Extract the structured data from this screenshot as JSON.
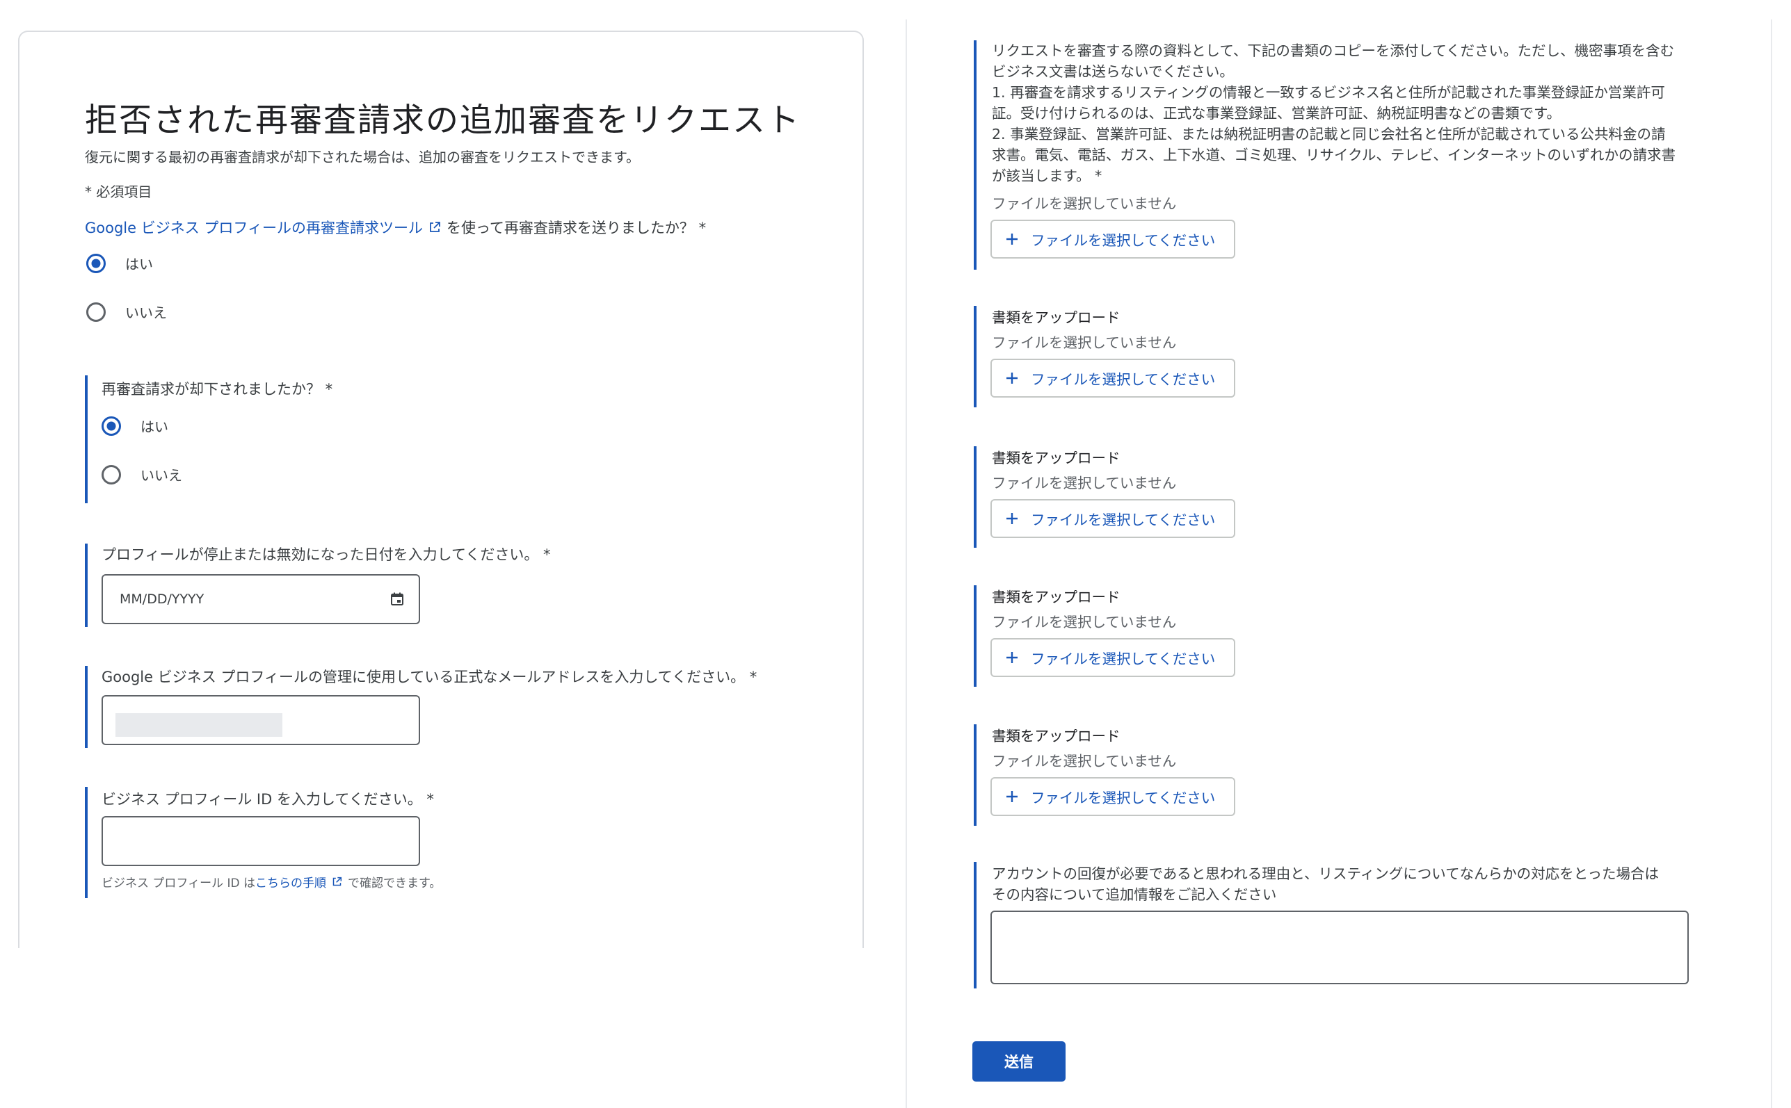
{
  "left": {
    "title": "拒否された再審査請求の追加審査をリクエスト",
    "subtitle": "復元に関する最初の再審査請求が却下された場合は、追加の審査をリクエストできます。",
    "required_note": "* 必須項目",
    "q_tool": {
      "link_text": "Google ビジネス プロフィールの再審査請求ツール",
      "suffix": "を使って再審査請求を送りましたか？ *",
      "options": [
        "はい",
        "いいえ"
      ],
      "selected": "はい"
    },
    "q_rejected": {
      "label": "再審査請求が却下されましたか？ *",
      "options": [
        "はい",
        "いいえ"
      ],
      "selected": "はい"
    },
    "date_field": {
      "label": "プロフィールが停止または無効になった日付を入力してください。 *",
      "placeholder": "MM/DD/YYYY"
    },
    "email_field": {
      "label": "Google ビジネス プロフィールの管理に使用している正式なメールアドレスを入力してください。 *"
    },
    "id_field": {
      "label": "ビジネス プロフィール ID を入力してください。 *",
      "help_prefix": "ビジネス プロフィール ID は",
      "help_link": "こちらの手順",
      "help_suffix": "で確認できます。"
    }
  },
  "right": {
    "instructions": [
      "リクエストを審査する際の資料として、下記の書類のコピーを添付してください。ただし、機密事項を含む",
      "ビジネス文書は送らないでください。",
      "1. 再審査を請求するリスティングの情報と一致するビジネス名と住所が記載された事業登録証か営業許可",
      "証。受け付けられるのは、正式な事業登録証、営業許可証、納税証明書などの書類です。",
      "2. 事業登録証、営業許可証、または納税証明書の記載と同じ会社名と住所が記載されている公共料金の請",
      "求書。電気、電話、ガス、上下水道、ゴミ処理、リサイクル、テレビ、インターネットのいずれかの請求書",
      "が該当します。 *"
    ],
    "uploads": [
      {
        "label": "",
        "status": "ファイルを選択していません",
        "button": "ファイルを選択してください"
      },
      {
        "label": "書類をアップロード",
        "status": "ファイルを選択していません",
        "button": "ファイルを選択してください"
      },
      {
        "label": "書類をアップロード",
        "status": "ファイルを選択していません",
        "button": "ファイルを選択してください"
      },
      {
        "label": "書類をアップロード",
        "status": "ファイルを選択していません",
        "button": "ファイルを選択してください"
      },
      {
        "label": "書類をアップロード",
        "status": "ファイルを選択していません",
        "button": "ファイルを選択してください"
      }
    ],
    "reason": {
      "label_line1": "アカウントの回復が必要であると思われる理由と、リスティングについてなんらかの対応をとった場合は",
      "label_line2": "その内容について追加情報をご記入ください"
    },
    "submit_label": "送信"
  },
  "colors": {
    "accent": "#1a57b8",
    "border": "#dadce0",
    "text": "#3c4043"
  }
}
